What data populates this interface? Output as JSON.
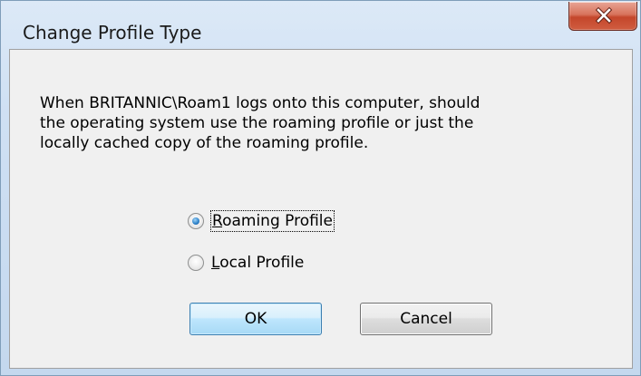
{
  "window": {
    "title": "Change Profile Type",
    "close_icon": "close-icon"
  },
  "message": {
    "line1": "When BRITANNIC\\Roam1 logs onto this computer, should",
    "line2": "the operating system use the roaming profile or just the",
    "line3": "locally cached copy of the roaming profile."
  },
  "options": [
    {
      "label": "Roaming Profile",
      "selected": true
    },
    {
      "label": "Local Profile",
      "selected": false
    }
  ],
  "buttons": {
    "ok_label": "OK",
    "cancel_label": "Cancel"
  },
  "colors": {
    "close_button": "#c4462b",
    "default_button_border": "#3c7fb1"
  }
}
